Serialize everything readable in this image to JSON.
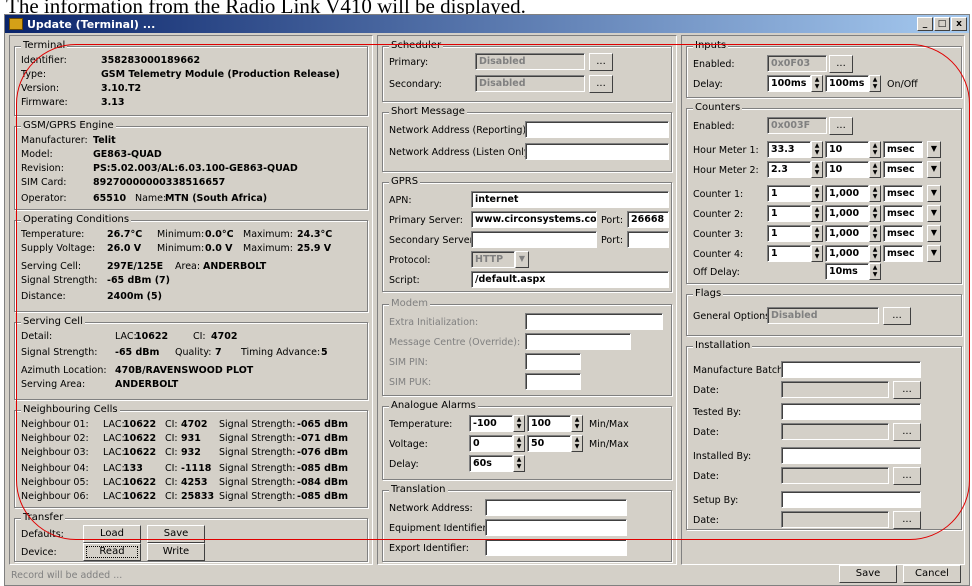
{
  "doc_text": "The information from the Radio Link V410 will be displayed.",
  "window": {
    "title": "Update (Terminal) ...",
    "buttons": {
      "minimize": "_",
      "maximize": "□",
      "close": "x"
    }
  },
  "terminal": {
    "title": "Terminal",
    "rows": [
      {
        "label": "Identifier:",
        "value": "358283000189662"
      },
      {
        "label": "Type:",
        "value": "GSM Telemetry Module (Production Release)"
      },
      {
        "label": "Version:",
        "value": "3.10.T2"
      },
      {
        "label": "Firmware:",
        "value": "3.13"
      }
    ]
  },
  "gsm": {
    "title": "GSM/GPRS Engine",
    "rows": [
      {
        "label": "Manufacturer:",
        "value": "Telit"
      },
      {
        "label": "Model:",
        "value": "GE863-QUAD"
      },
      {
        "label": "Revision:",
        "value": "PS:5.02.003/AL:6.03.100-GE863-QUAD"
      },
      {
        "label": "SIM Card:",
        "value": "89270000000338516657"
      }
    ],
    "operator_label": "Operator:",
    "operator_code": "65510",
    "name_label": "Name:",
    "operator_name": "MTN (South Africa)"
  },
  "conditions": {
    "title": "Operating Conditions",
    "temp_label": "Temperature:",
    "temp": "26.7°C",
    "temp_min_label": "Minimum:",
    "temp_min": "0.0°C",
    "temp_max_label": "Maximum:",
    "temp_max": "24.3°C",
    "volt_label": "Supply Voltage:",
    "volt": "26.0 V",
    "volt_min_label": "Minimum:",
    "volt_min": "0.0 V",
    "volt_max_label": "Maximum:",
    "volt_max": "25.9 V",
    "cell_label": "Serving Cell:",
    "cell": "297E/125E",
    "area_label": "Area:",
    "area": "ANDERBOLT",
    "signal_label": "Signal Strength:",
    "signal": "-65 dBm (7)",
    "distance_label": "Distance:",
    "distance": "2400m (5)"
  },
  "serving": {
    "title": "Serving Cell",
    "detail_label": "Detail:",
    "lac_label": "LAC:",
    "lac": "10622",
    "ci_label": "CI:",
    "ci": "4702",
    "signal_label": "Signal Strength:",
    "signal": "-65 dBm",
    "quality_label": "Quality:",
    "quality": "7",
    "ta_label": "Timing Advance:",
    "ta": "5",
    "azimuth_label": "Azimuth Location:",
    "azimuth": "470B/RAVENSWOOD PLOT",
    "area_label": "Serving Area:",
    "area": "ANDERBOLT"
  },
  "neighbours": {
    "title": "Neighbouring Cells",
    "lac_label": "LAC:",
    "ci_label": "CI:",
    "ss_label": "Signal Strength:",
    "rows": [
      {
        "name": "Neighbour 01:",
        "lac": "10622",
        "ci": "4702",
        "ss": "-065 dBm"
      },
      {
        "name": "Neighbour 02:",
        "lac": "10622",
        "ci": "931",
        "ss": "-071 dBm"
      },
      {
        "name": "Neighbour 03:",
        "lac": "10622",
        "ci": "932",
        "ss": "-076 dBm"
      },
      {
        "name": "Neighbour 04:",
        "lac": "133",
        "ci": "-1118",
        "ss": "-085 dBm"
      },
      {
        "name": "Neighbour 05:",
        "lac": "10622",
        "ci": "4253",
        "ss": "-084 dBm"
      },
      {
        "name": "Neighbour 06:",
        "lac": "10622",
        "ci": "25833",
        "ss": "-085 dBm"
      }
    ]
  },
  "transfer": {
    "title": "Transfer",
    "defaults_label": "Defaults:",
    "device_label": "Device:",
    "load": "Load",
    "save": "Save",
    "read": "Read",
    "write": "Write"
  },
  "scheduler": {
    "title": "Scheduler",
    "primary_label": "Primary:",
    "primary": "Disabled",
    "secondary_label": "Secondary:",
    "secondary": "Disabled",
    "browse": "..."
  },
  "sms": {
    "title": "Short Message",
    "reporting_label": "Network Address (Reporting):",
    "listen_label": "Network Address (Listen Only):"
  },
  "gprs": {
    "title": "GPRS",
    "apn_label": "APN:",
    "apn": "internet",
    "primary_label": "Primary Server:",
    "primary": "www.circonsystems.co.z",
    "port_label": "Port:",
    "port": "26668",
    "secondary_label": "Secondary Server:",
    "port2_label": "Port:",
    "protocol_label": "Protocol:",
    "protocol": "HTTP",
    "script_label": "Script:",
    "script": "/default.aspx"
  },
  "modem": {
    "title": "Modem",
    "init_label": "Extra Initialization:",
    "smsc_label": "Message Centre (Override):",
    "pin_label": "SIM PIN:",
    "puk_label": "SIM PUK:"
  },
  "analogue": {
    "title": "Analogue Alarms",
    "temp_label": "Temperature:",
    "temp_min": "-100",
    "temp_max": "100",
    "minmax": "Min/Max",
    "volt_label": "Voltage:",
    "volt_min": "0",
    "volt_max": "50",
    "minmax2": "Min/Max",
    "delay_label": "Delay:",
    "delay": "60s"
  },
  "translation": {
    "title": "Translation",
    "net_label": "Network Address:",
    "equip_label": "Equipment Identifier:",
    "export_label": "Export Identifier:"
  },
  "inputs": {
    "title": "Inputs",
    "enabled_label": "Enabled:",
    "enabled": "0x0F03",
    "delay_label": "Delay:",
    "delay1": "100ms",
    "delay2": "100ms",
    "onoff": "On/Off",
    "browse": "..."
  },
  "counters": {
    "title": "Counters",
    "enabled_label": "Enabled:",
    "enabled": "0x003F",
    "browse": "...",
    "rows": [
      {
        "label": "Hour Meter 1:",
        "a": "33.3",
        "b": "10",
        "unit": "msec"
      },
      {
        "label": "Hour Meter 2:",
        "a": "2.3",
        "b": "10",
        "unit": "msec"
      },
      {
        "label": "Counter 1:",
        "a": "1",
        "b": "1,000",
        "unit": "msec"
      },
      {
        "label": "Counter 2:",
        "a": "1",
        "b": "1,000",
        "unit": "msec"
      },
      {
        "label": "Counter 3:",
        "a": "1",
        "b": "1,000",
        "unit": "msec"
      },
      {
        "label": "Counter 4:",
        "a": "1",
        "b": "1,000",
        "unit": "msec"
      }
    ],
    "off_delay_label": "Off Delay:",
    "off_delay": "10ms"
  },
  "flags": {
    "title": "Flags",
    "general_label": "General Options:",
    "general": "Disabled",
    "browse": "..."
  },
  "installation": {
    "title": "Installation",
    "batch_label": "Manufacture Batch:",
    "date_label": "Date:",
    "tested_label": "Tested By:",
    "installed_label": "Installed By:",
    "setup_label": "Setup By:",
    "browse": "..."
  },
  "footer": {
    "status": "Record will be added ...",
    "save": "Save",
    "cancel": "Cancel"
  }
}
